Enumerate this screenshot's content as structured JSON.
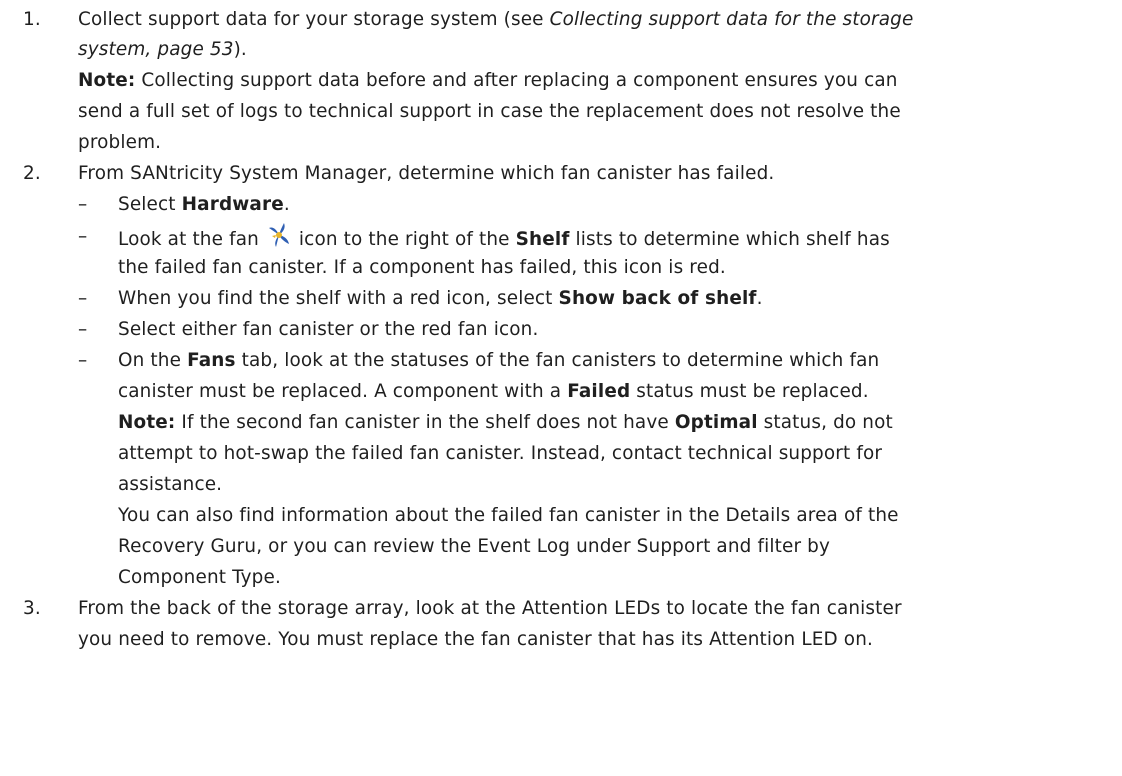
{
  "steps": [
    {
      "number": "1.",
      "text_before": "Collect support data for your storage system (see ",
      "link_text": "Collecting support data for the storage system, page 53",
      "text_after": ").",
      "note": {
        "label": "Note:",
        "text": "Collecting support data before and after replacing a component ensures you can send a full set of logs to technical support in case the replacement does not resolve the problem."
      }
    },
    {
      "number": "2.",
      "text": "From SANtricity System Manager, determine which fan canister has failed.",
      "substeps": [
        {
          "dash": "–",
          "pre": "Select ",
          "bold": "Hardware",
          "post": "."
        },
        {
          "dash": "–",
          "pre": "Look at the fan ",
          "icon": "fan-icon",
          "mid": " icon to the right of the ",
          "bold": "Shelf",
          "post": " lists to determine which shelf has the failed fan canister. If a component has failed, this icon is red."
        },
        {
          "dash": "–",
          "pre": "When you find the shelf with a red icon, select ",
          "bold": "Show back of shelf",
          "post": "."
        },
        {
          "dash": "–",
          "text": "Select either fan canister or the red fan icon."
        },
        {
          "dash": "–",
          "pre": "On the ",
          "bold": "Fans",
          "mid": " tab, look at the statuses of the fan canisters to determine which fan canister must be replaced. A component with a ",
          "bold2": "Failed",
          "post": " status must be replaced.",
          "note": {
            "label": "Note:",
            "pre": " If the second fan canister in the shelf does not have ",
            "bold": "Optimal",
            "post": " status, do not attempt to hot-swap the failed fan canister. Instead, contact technical support for assistance."
          },
          "extra": "You can also find information about the failed fan canister in the Details area of the Recovery Guru, or you can review the Event Log under Support and filter by Component Type."
        }
      ]
    },
    {
      "number": "3.",
      "text": "From the back of the storage array, look at the Attention LEDs to locate the fan canister you need to remove. You must replace the fan canister that has its Attention LED on."
    }
  ],
  "colors": {
    "text": "#1f1f1f",
    "fan_icon_blue": "#2f5fb3",
    "fan_icon_yellow": "#e7b52a"
  }
}
